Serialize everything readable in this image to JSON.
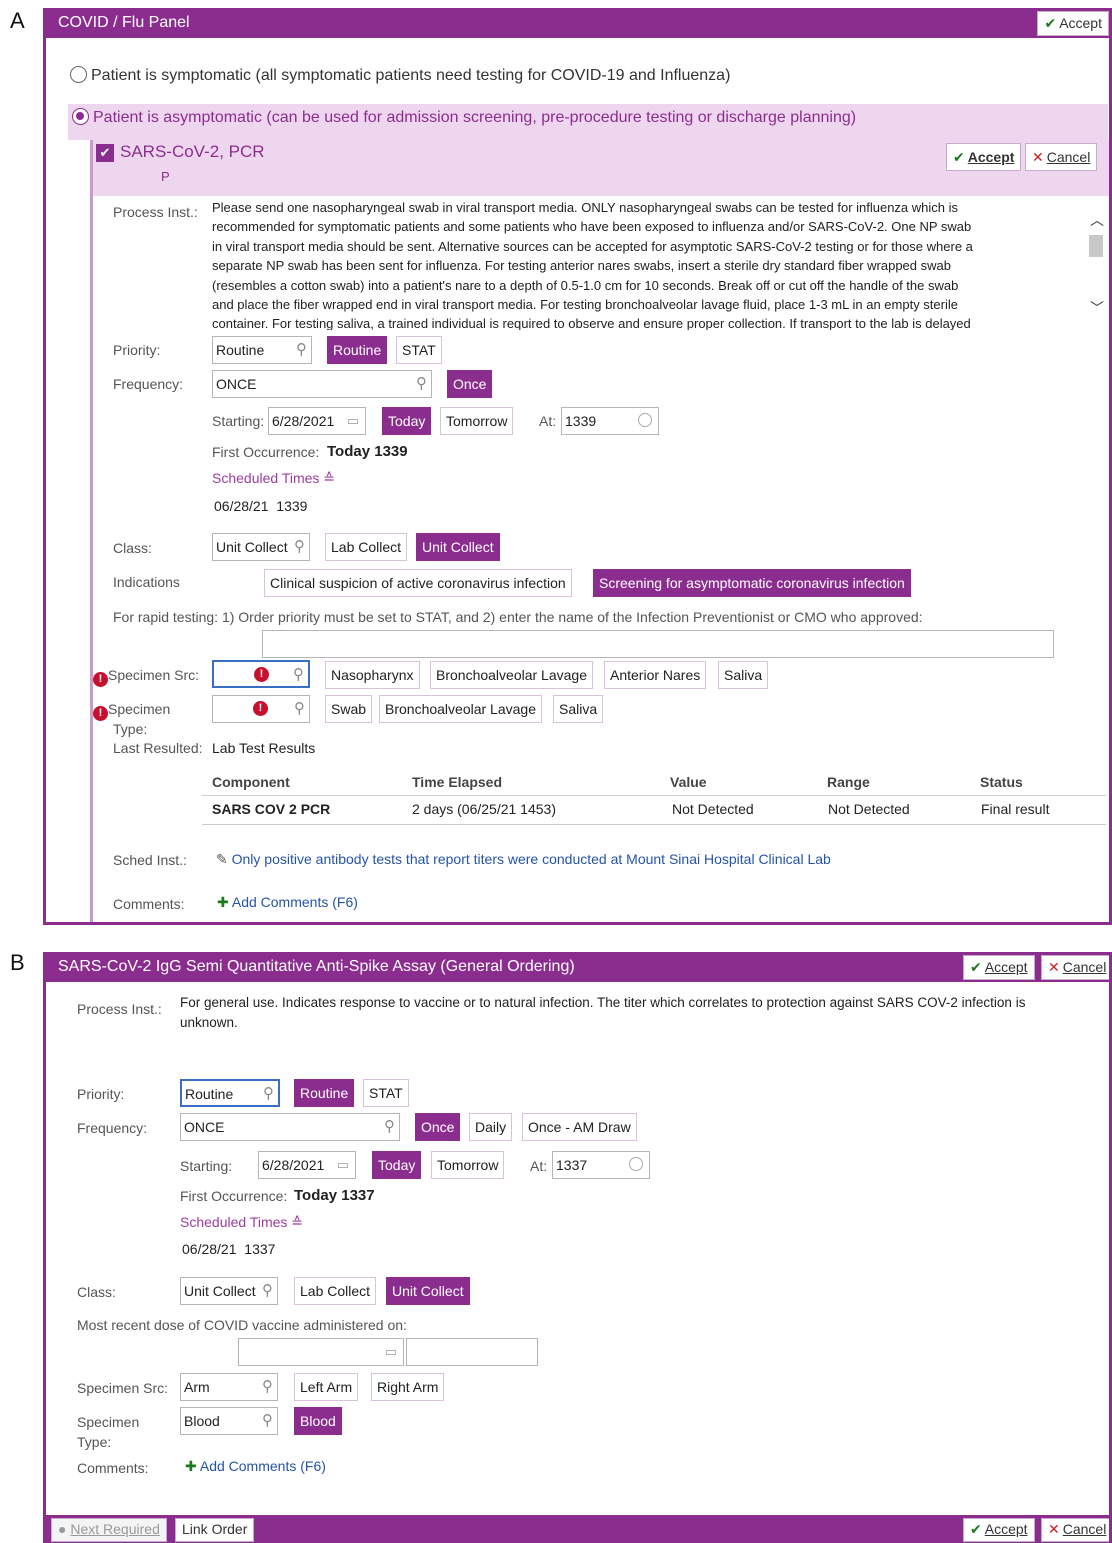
{
  "panel_a": {
    "letter": "A",
    "title": "COVID / Flu Panel",
    "accept": "Accept",
    "radio_symptomatic": "Patient is symptomatic (all symptomatic patients need testing for COVID-19 and Influenza)",
    "radio_asymptomatic": "Patient is asymptomatic (can be used for admission screening, pre-procedure testing or discharge planning)",
    "order_name": "SARS-CoV-2, PCR",
    "order_sub": "P",
    "order_accept": "Accept",
    "order_cancel": "Cancel",
    "process_label": "Process Inst.:",
    "process_lines": [
      "Please send one nasopharyngeal swab in viral transport media. ONLY nasopharyngeal swabs can be tested for influenza which is",
      "recommended for symptomatic patients and some patients who have been exposed to influenza and/or SARS-CoV-2.  One NP swab",
      "in viral transport media should be sent.  Alternative sources can be accepted for asymptotic SARS-CoV-2 testing or for those where a",
      "separate NP swab has been sent for influenza. For testing anterior nares swabs, insert a sterile dry standard fiber wrapped swab",
      "(resembles a cotton swab) into a patient's nare to a depth of 0.5-1.0 cm for 10 seconds. Break off or cut off the handle of the swab",
      "and place the fiber wrapped end in viral transport media. For testing bronchoalveolar lavage fluid, place 1-3 mL in an empty sterile",
      "container. For testing saliva, a trained individual is required to observe and ensure proper collection. If transport to the lab is delayed"
    ],
    "priority_label": "Priority:",
    "priority_value": "Routine",
    "priority_opts": [
      "Routine",
      "STAT"
    ],
    "frequency_label": "Frequency:",
    "frequency_value": "ONCE",
    "frequency_opts": [
      "Once"
    ],
    "starting_label": "Starting:",
    "starting_value": "6/28/2021",
    "today": "Today",
    "tomorrow": "Tomorrow",
    "at_label": "At:",
    "at_value": "1339",
    "first_occ_label": "First Occurrence:",
    "first_occ_value": "Today 1339",
    "scheduled_times": "Scheduled Times",
    "sched_date": "06/28/21",
    "sched_time": "1339",
    "class_label": "Class:",
    "class_value": "Unit Collect",
    "class_opts": [
      "Lab Collect",
      "Unit Collect"
    ],
    "indications_label": "Indications",
    "indications_opts": [
      "Clinical suspicion of active coronavirus infection",
      "Screening for asymptomatic coronavirus infection"
    ],
    "rapid_text": "For rapid testing: 1) Order priority must be set to STAT, and 2) enter the name of the Infection Preventionist or CMO who approved:",
    "spec_src_label": "Specimen Src:",
    "spec_src_opts": [
      "Nasopharynx",
      "Bronchoalveolar Lavage",
      "Anterior Nares",
      "Saliva"
    ],
    "spec_type_label1": "Specimen",
    "spec_type_label2": "Type:",
    "spec_type_opts": [
      "Swab",
      "Bronchoalveolar Lavage",
      "Saliva"
    ],
    "last_resulted_label": "Last Resulted:",
    "last_resulted_value": "Lab Test Results",
    "table_headers": [
      "Component",
      "Time Elapsed",
      "Value",
      "Range",
      "Status"
    ],
    "table_row": [
      "SARS COV 2 PCR",
      "2 days (06/25/21 1453)",
      "Not Detected",
      "Not Detected",
      "Final result"
    ],
    "sched_inst_label": "Sched Inst.:",
    "sched_inst_value": "Only positive antibody tests that report titers were conducted at Mount Sinai Hospital Clinical Lab",
    "comments_label": "Comments:",
    "add_comments": "Add Comments (F6)"
  },
  "panel_b": {
    "letter": "B",
    "title": "SARS-CoV-2 IgG Semi Quantitative Anti-Spike Assay (General Ordering)",
    "accept": "Accept",
    "cancel": "Cancel",
    "process_label": "Process Inst.:",
    "process_lines": [
      "For general use.  Indicates response to vaccine or to natural infection.  The titer which correlates to protection against SARS COV-2 infection is",
      "unknown."
    ],
    "priority_label": "Priority:",
    "priority_value": "Routine",
    "priority_opts": [
      "Routine",
      "STAT"
    ],
    "frequency_label": "Frequency:",
    "frequency_value": "ONCE",
    "frequency_opts": [
      "Once",
      "Daily",
      "Once - AM Draw"
    ],
    "starting_label": "Starting:",
    "starting_value": "6/28/2021",
    "today": "Today",
    "tomorrow": "Tomorrow",
    "at_label": "At:",
    "at_value": "1337",
    "first_occ_label": "First Occurrence:",
    "first_occ_value": "Today 1337",
    "scheduled_times": "Scheduled Times",
    "sched_date": "06/28/21",
    "sched_time": "1337",
    "class_label": "Class:",
    "class_value": "Unit Collect",
    "class_opts": [
      "Lab Collect",
      "Unit Collect"
    ],
    "vaccine_label": "Most recent dose of COVID vaccine administered on:",
    "spec_src_label": "Specimen Src:",
    "spec_src_value": "Arm",
    "spec_src_opts": [
      "Left Arm",
      "Right Arm"
    ],
    "spec_type_label1": "Specimen",
    "spec_type_label2": "Type:",
    "spec_type_value": "Blood",
    "spec_type_opts": [
      "Blood"
    ],
    "comments_label": "Comments:",
    "add_comments": "Add Comments (F6)",
    "next_required": "Next Required",
    "link_order": "Link Order",
    "footer_accept": "Accept",
    "footer_cancel": "Cancel"
  }
}
